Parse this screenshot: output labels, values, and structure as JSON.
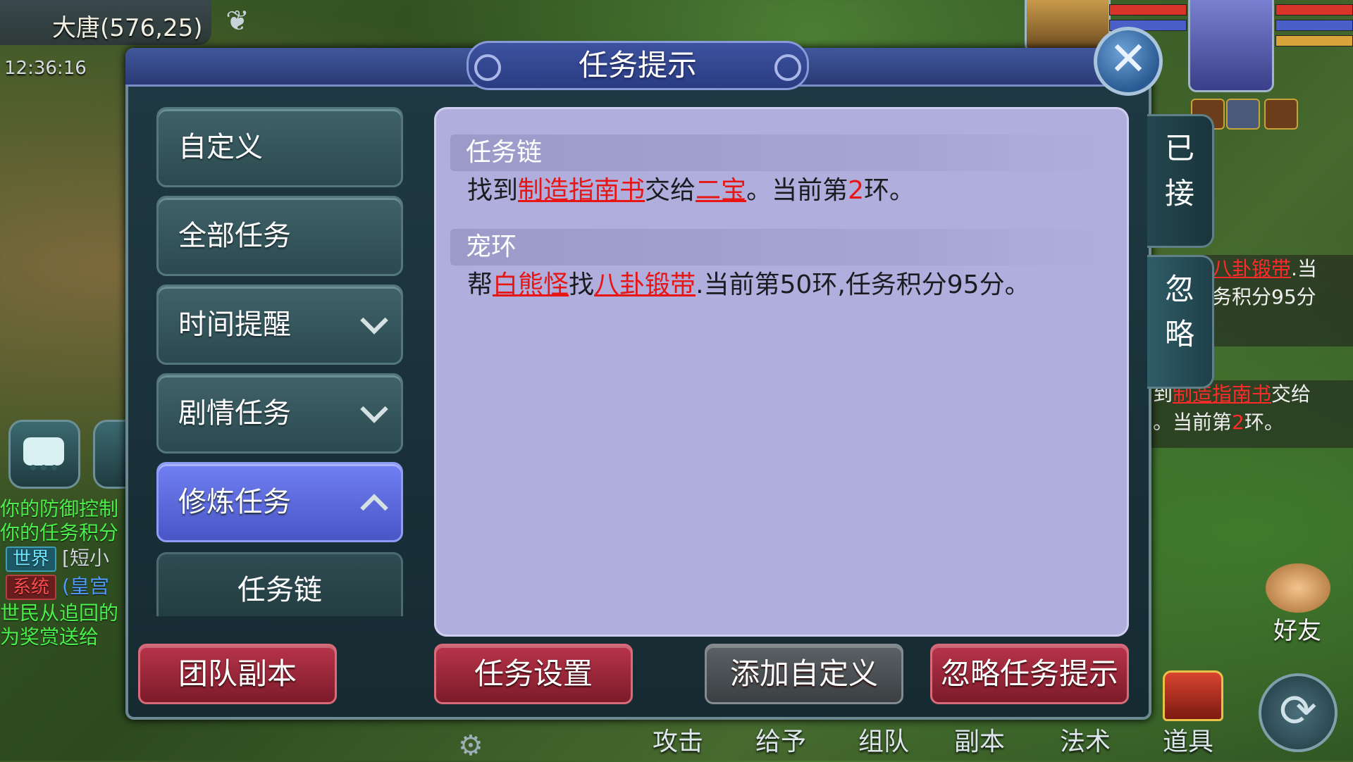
{
  "hud": {
    "map_name": "大唐(576,25)",
    "clock": "12:36:16",
    "chat_lines": [
      {
        "text": "你的防御控制"
      },
      {
        "text": "你的任务积分"
      }
    ],
    "chat_channels": [
      {
        "channel": "世界",
        "text": "[短小"
      },
      {
        "channel": "系统",
        "text": "(皇宫"
      }
    ],
    "chat_tail": [
      "世民从追回的",
      "为奖赏送给"
    ],
    "tracker": {
      "line1_link": "八卦锻带",
      "line1_tail": ".当",
      "line2": "务积分95分",
      "line3_prefix": "到",
      "line3_link": "制造指南书",
      "line3_tail": "交给",
      "line4_prefix": "。当前第",
      "line4_num": "2",
      "line4_tail": "环。"
    },
    "friend_label": "好友",
    "bottom_items": [
      "攻击",
      "给予",
      "组队",
      "副本",
      "法术",
      "道具"
    ]
  },
  "dialog": {
    "title": "任务提示",
    "menu": [
      {
        "label": "自定义",
        "chevron": "none",
        "active": false
      },
      {
        "label": "全部任务",
        "chevron": "none",
        "active": false
      },
      {
        "label": "时间提醒",
        "chevron": "down",
        "active": false
      },
      {
        "label": "剧情任务",
        "chevron": "down",
        "active": false
      },
      {
        "label": "修炼任务",
        "chevron": "up",
        "active": true
      }
    ],
    "sub_item": "任务链",
    "sections": [
      {
        "heading": "任务链",
        "parts": [
          {
            "t": "找到",
            "s": "plain"
          },
          {
            "t": "制造指南书",
            "s": "link"
          },
          {
            "t": "交给",
            "s": "plain"
          },
          {
            "t": "二宝",
            "s": "link"
          },
          {
            "t": "。当前第",
            "s": "plain"
          },
          {
            "t": "2",
            "s": "num"
          },
          {
            "t": "环。",
            "s": "plain"
          }
        ]
      },
      {
        "heading": "宠环",
        "parts": [
          {
            "t": "帮",
            "s": "plain"
          },
          {
            "t": "白熊怪",
            "s": "link"
          },
          {
            "t": "找",
            "s": "plain"
          },
          {
            "t": "八卦锻带",
            "s": "link"
          },
          {
            "t": ".当前第50环,任务积分95分。",
            "s": "plain"
          }
        ]
      }
    ],
    "side_tabs": [
      "已接",
      "忽略"
    ],
    "buttons": {
      "team_dungeon": "团队副本",
      "task_settings": "任务设置",
      "add_custom": "添加自定义",
      "ignore_hint": "忽略任务提示"
    }
  },
  "colors": {
    "link_red": "#e81515",
    "menu_active": "#5a66de",
    "button_red": "#9a2436",
    "content_bg": "#b0aedc"
  },
  "icons": [
    "heart-icon",
    "chat-icon",
    "close-icon",
    "chevron-down-icon",
    "chevron-up-icon",
    "handshake-icon",
    "refresh-icon",
    "gear-icon",
    "treasure-chest-icon"
  ]
}
